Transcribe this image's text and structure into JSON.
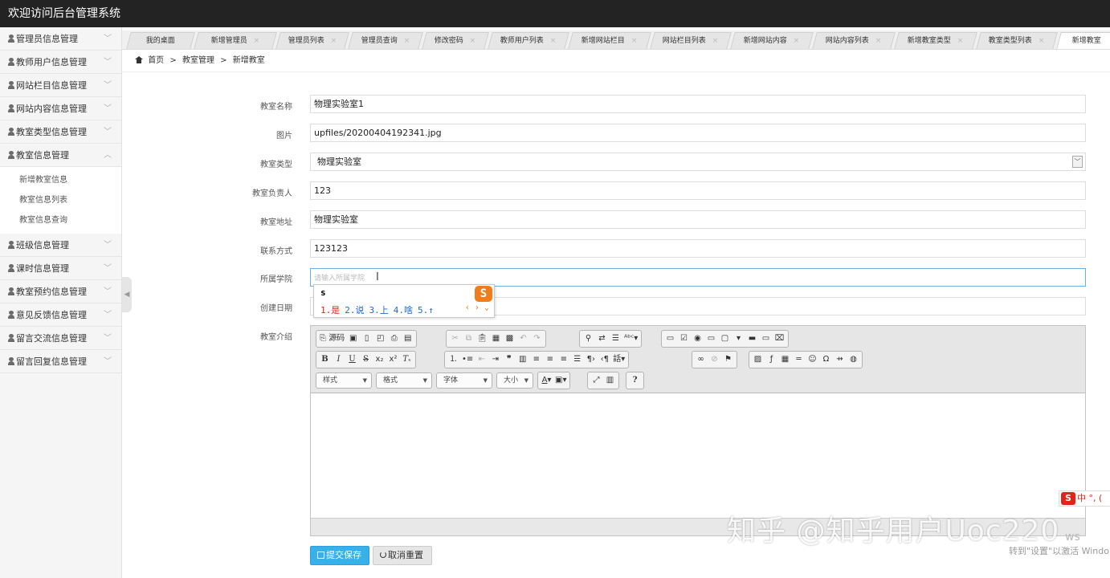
{
  "app": {
    "title": "欢迎访问后台管理系统"
  },
  "sidebar": {
    "menu_before": [
      {
        "label": "管理员信息管理"
      },
      {
        "label": "教师用户信息管理"
      },
      {
        "label": "网站栏目信息管理"
      },
      {
        "label": "网站内容信息管理"
      },
      {
        "label": "教室类型信息管理"
      },
      {
        "label": "教室信息管理"
      }
    ],
    "submenu": [
      {
        "label": "新增教室信息"
      },
      {
        "label": "教室信息列表"
      },
      {
        "label": "教室信息查询"
      }
    ],
    "menu_after": [
      {
        "label": "班级信息管理"
      },
      {
        "label": "课时信息管理"
      },
      {
        "label": "教室预约信息管理"
      },
      {
        "label": "意见反馈信息管理"
      },
      {
        "label": "留言交流信息管理"
      },
      {
        "label": "留言回复信息管理"
      }
    ],
    "collapse_glyph": "◀"
  },
  "tabs": [
    {
      "label": "我的桌面",
      "closable": false
    },
    {
      "label": "新增管理员",
      "closable": true
    },
    {
      "label": "管理员列表",
      "closable": true
    },
    {
      "label": "管理员查询",
      "closable": true
    },
    {
      "label": "修改密码",
      "closable": true
    },
    {
      "label": "教师用户列表",
      "closable": true
    },
    {
      "label": "新增网站栏目",
      "closable": true
    },
    {
      "label": "网站栏目列表",
      "closable": true
    },
    {
      "label": "新增网站内容",
      "closable": true
    },
    {
      "label": "网站内容列表",
      "closable": true
    },
    {
      "label": "新增教室类型",
      "closable": true
    },
    {
      "label": "教室类型列表",
      "closable": true
    },
    {
      "label": "新增教室",
      "closable": false,
      "active": true
    }
  ],
  "breadcrumb": {
    "home": "首页",
    "sep1": ">",
    "section": "教室管理",
    "sep2": ">",
    "current": "新增教室"
  },
  "form": {
    "name": {
      "label": "教室名称",
      "value": "物理实验室1"
    },
    "image": {
      "label": "图片",
      "value": "upfiles/20200404192341.jpg"
    },
    "type": {
      "label": "教室类型",
      "value": "物理实验室"
    },
    "owner": {
      "label": "教室负责人",
      "value": "123"
    },
    "address": {
      "label": "教室地址",
      "value": "物理实验室"
    },
    "contact": {
      "label": "联系方式",
      "value": "123123"
    },
    "college": {
      "label": "所属学院",
      "value": "",
      "placeholder": "请输入所属学院"
    },
    "created": {
      "label": "创建日期",
      "value": ""
    },
    "intro": {
      "label": "教室介绍"
    }
  },
  "ime": {
    "input": "s",
    "candidates": [
      "1.是",
      "2.说",
      "3.上",
      "4.啥",
      "5.↑"
    ],
    "logo": "S",
    "nav": "‹ › ⌄"
  },
  "editor": {
    "source_label": "源码",
    "style_combo": "样式",
    "format_combo": "格式",
    "font_combo": "字体",
    "size_combo": "大小",
    "help": "?"
  },
  "buttons": {
    "submit": "提交保存",
    "reset": "取消重置"
  },
  "overlay": {
    "watermark": "知乎 @知乎用户Uoc220",
    "activate_text": "转到\"设置\"以激活 Windo",
    "activate_ws": "ws",
    "tray_text": "中 °, ("
  },
  "colors": {
    "topbar": "#232323",
    "primary_button": "#38b0ea",
    "ime_logo": "#f07c1b"
  }
}
